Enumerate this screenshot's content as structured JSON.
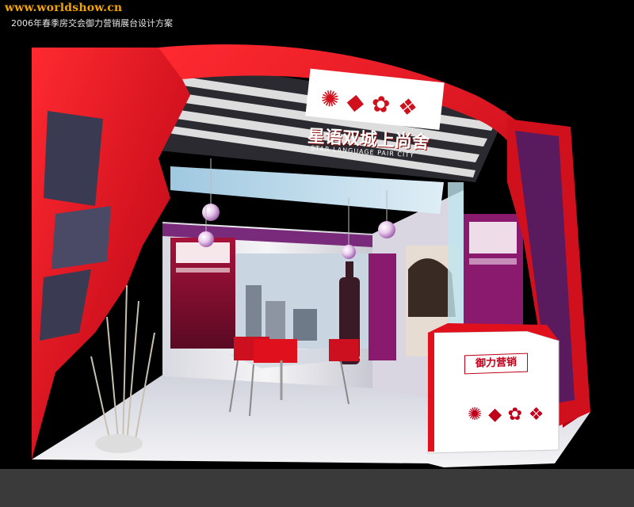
{
  "watermark": {
    "text": "www.worldshow.cn"
  },
  "caption": {
    "text": "2006年春季房交会御力营销展台设计方案"
  },
  "booth": {
    "counter_label": "御力营销",
    "sub_brand": "星语双城上尚舍",
    "sub_brand_en": "STAR LANGUAGE PAIR CITY"
  },
  "colors": {
    "background": "#000000",
    "frame_red": "#e0101c",
    "dark_red": "#9a0010",
    "purple": "#8a1a6e",
    "floor": "#e8e8ec",
    "watermark": "#f2a400"
  }
}
